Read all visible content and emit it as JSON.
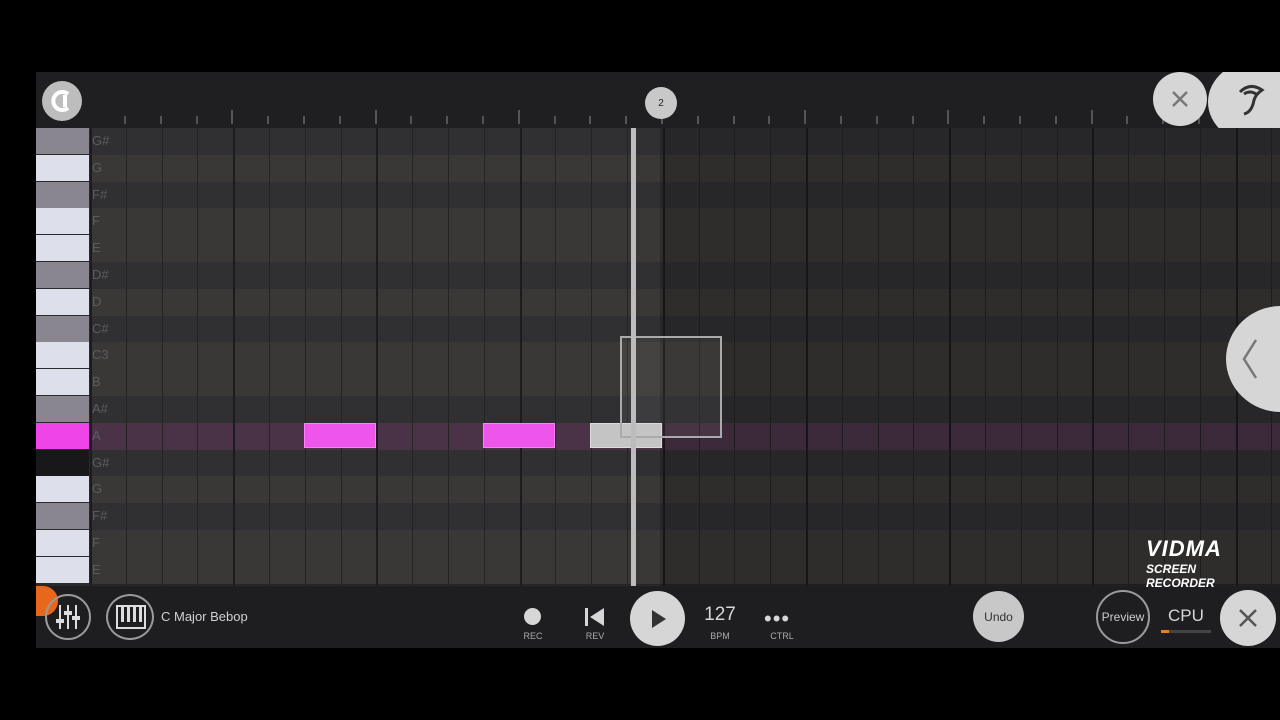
{
  "ruler": {
    "marker_label": "2"
  },
  "rows": [
    {
      "label": "G#",
      "kind": "b"
    },
    {
      "label": "G",
      "kind": "w"
    },
    {
      "label": "F#",
      "kind": "b"
    },
    {
      "label": "F",
      "kind": "w"
    },
    {
      "label": "E",
      "kind": "w"
    },
    {
      "label": "D#",
      "kind": "b"
    },
    {
      "label": "D",
      "kind": "w"
    },
    {
      "label": "C#",
      "kind": "b"
    },
    {
      "label": "C3",
      "kind": "w"
    },
    {
      "label": "B",
      "kind": "w"
    },
    {
      "label": "A#",
      "kind": "b"
    },
    {
      "label": "A",
      "kind": "sel"
    },
    {
      "label": "G#",
      "kind": "dk"
    },
    {
      "label": "G",
      "kind": "w"
    },
    {
      "label": "F#",
      "kind": "b"
    },
    {
      "label": "F",
      "kind": "w"
    },
    {
      "label": "E",
      "kind": "w"
    }
  ],
  "notes_on_row": "A",
  "toolbar": {
    "preset_name": "C Major Bebop",
    "rec_label": "REC",
    "rev_label": "REV",
    "bpm_value": "127",
    "bpm_label": "BPM",
    "ctrl_label": "CTRL",
    "undo_label": "Undo",
    "preview_label": "Preview",
    "cpu_label": "CPU",
    "cpu_level": 0.15
  },
  "watermark": {
    "logo": "VIDMA",
    "sub": "SCREEN RECORDER"
  },
  "colors": {
    "note": "#ee55ea",
    "ghost_note": "#c4c4c4",
    "accent": "#f07d16"
  }
}
